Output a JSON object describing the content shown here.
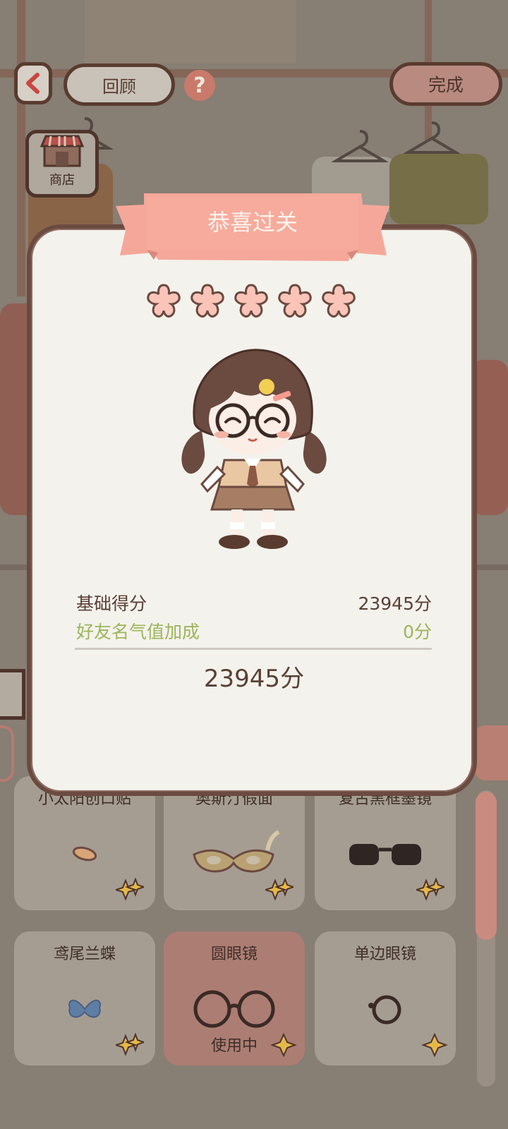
{
  "header": {
    "back_icon": "chevron-left-icon",
    "review_label": "回顾",
    "help_icon": "question-icon",
    "help_glyph": "?",
    "done_label": "完成",
    "shop_label": "商店"
  },
  "result": {
    "title": "恭喜过关",
    "stars_earned": 5,
    "stars_total": 5,
    "base_score_label": "基础得分",
    "base_score_value": "23945分",
    "friend_bonus_label": "好友名气值加成",
    "friend_bonus_value": "0分",
    "total_score": "23945分"
  },
  "items": [
    {
      "name": "小太阳创口贴",
      "status": "",
      "art": "bandage"
    },
    {
      "name": "奥斯汀假面",
      "status": "",
      "art": "mask"
    },
    {
      "name": "复古黑框墨镜",
      "status": "",
      "art": "sunglasses"
    },
    {
      "name": "鸢尾兰蝶",
      "status": "",
      "art": "butterfly"
    },
    {
      "name": "圆眼镜",
      "status": "使用中",
      "art": "round-glasses"
    },
    {
      "name": "单边眼镜",
      "status": "",
      "art": "monocle"
    }
  ],
  "colors": {
    "accent": "#f5a89a",
    "friend_bonus": "#9cb55a",
    "outline": "#5a3b30"
  }
}
